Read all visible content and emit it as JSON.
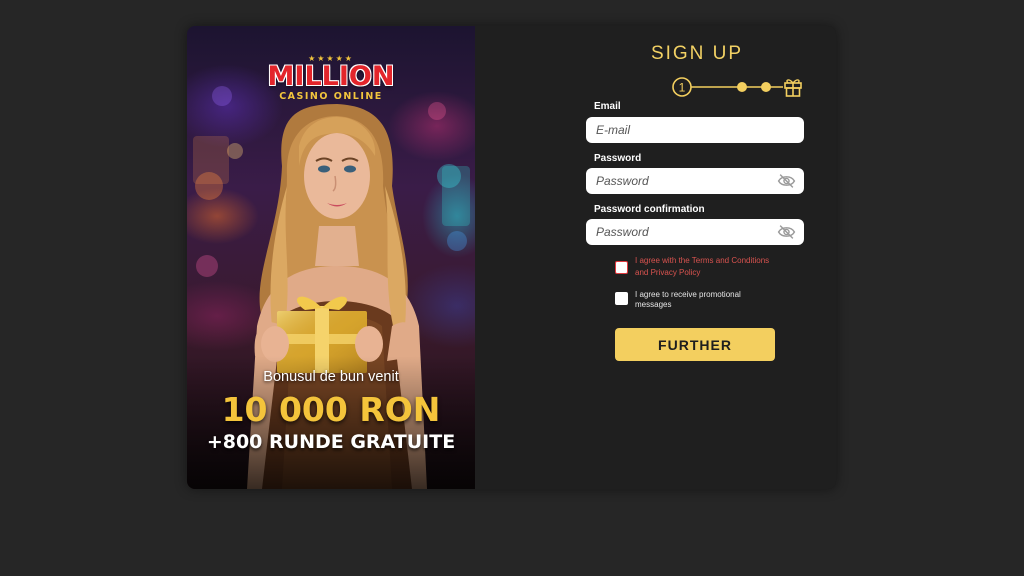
{
  "promo": {
    "logo_stars": "★★★★★",
    "logo_main": "MILLION",
    "logo_sub": "CASINO ONLINE",
    "caption": "Bonusul de bun venit",
    "amount": "10 000 RON",
    "spins": "+800 RUNDE GRATUITE"
  },
  "form": {
    "title": "SIGN UP",
    "stepper": {
      "current_step": "1",
      "total_steps": 3,
      "final_icon": "gift-icon"
    },
    "email": {
      "label": "Email",
      "placeholder": "E-mail",
      "value": ""
    },
    "password": {
      "label": "Password",
      "placeholder": "Password",
      "value": "",
      "toggle_icon": "eye-off-icon"
    },
    "password_confirmation": {
      "label": "Password confirmation",
      "placeholder": "Password",
      "value": "",
      "toggle_icon": "eye-off-icon"
    },
    "terms": {
      "prefix": "I agree with the",
      "terms_link": "Terms and Conditions",
      "conjunction": "and",
      "privacy_link": "Privacy Policy",
      "checked": false
    },
    "promotional": {
      "label": "I agree to receive promotional messages",
      "checked": false
    },
    "submit_label": "FURTHER"
  },
  "colors": {
    "page_bg": "#262626",
    "panel_bg": "#1f1f1f",
    "accent": "#f3cf5f",
    "title": "#f2d164",
    "error": "#d9534f",
    "logo_red": "#e3252b"
  }
}
